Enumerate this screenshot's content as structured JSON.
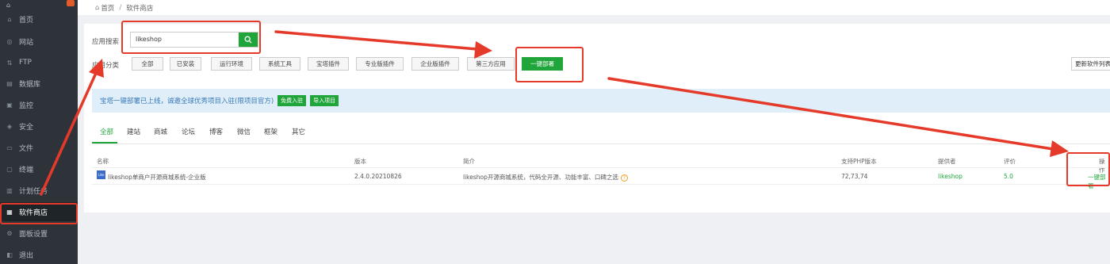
{
  "sidebar": {
    "items": [
      {
        "label": "首页",
        "icon": "home-icon"
      },
      {
        "label": "网站",
        "icon": "globe-icon"
      },
      {
        "label": "FTP",
        "icon": "ftp-icon"
      },
      {
        "label": "数据库",
        "icon": "database-icon"
      },
      {
        "label": "监控",
        "icon": "monitor-icon"
      },
      {
        "label": "安全",
        "icon": "shield-icon"
      },
      {
        "label": "文件",
        "icon": "folder-icon"
      },
      {
        "label": "终端",
        "icon": "terminal-icon"
      },
      {
        "label": "计划任务",
        "icon": "clock-icon"
      },
      {
        "label": "软件商店",
        "icon": "grid-icon",
        "active": true
      },
      {
        "label": "面板设置",
        "icon": "gear-icon"
      },
      {
        "label": "退出",
        "icon": "logout-icon"
      }
    ]
  },
  "breadcrumb": {
    "home": "首页",
    "separator": "/",
    "current": "软件商店"
  },
  "search": {
    "label": "应用搜索",
    "value": "likeshop"
  },
  "category": {
    "label": "应用分类",
    "buttons": [
      "全部",
      "已安装",
      "运行环境",
      "系统工具",
      "宝塔插件",
      "专业版插件",
      "企业版插件",
      "第三方应用",
      "一键部署"
    ],
    "selected": "一键部署",
    "refresh": "更新软件列表"
  },
  "notice": {
    "text": "宝塔一键部署已上线，诚邀全球优秀项目入驻(限项目官方)",
    "btn_join": "免费入驻",
    "btn_import": "导入项目"
  },
  "tabs": [
    "全部",
    "建站",
    "商城",
    "论坛",
    "博客",
    "微信",
    "框架",
    "其它"
  ],
  "table": {
    "headers": [
      "名称",
      "版本",
      "简介",
      "支持PHP版本",
      "提供者",
      "评价",
      "操作"
    ],
    "rows": [
      {
        "name": "likeshop单商户开源商城系统-企业版",
        "version": "2.4.0.20210826",
        "intro": "likeshop开源商城系统，代码全开源、功能丰富、口碑之选",
        "php": "72,73,74",
        "provider": "likeshop",
        "rating": "5.0",
        "action": "一键部署"
      }
    ]
  },
  "colors": {
    "accent": "#20a53a",
    "annotation": "#e53a2a",
    "sidebar": "#2d3338"
  }
}
